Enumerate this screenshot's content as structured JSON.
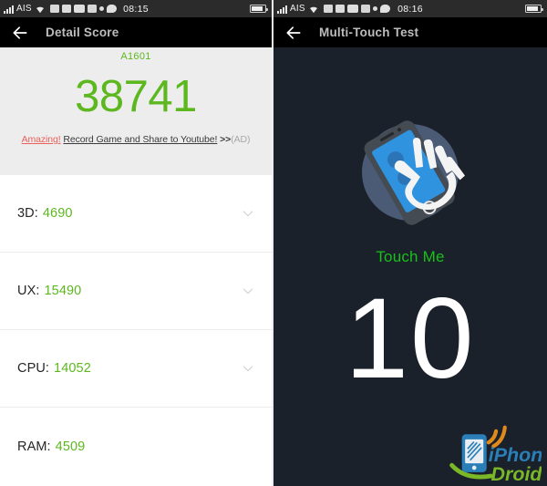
{
  "left_screen": {
    "status_bar": {
      "carrier": "AIS",
      "time": "08:15",
      "icons": [
        "signal-bars-icon",
        "wifi-icon",
        "app-icon",
        "app-icon",
        "app-icon",
        "app-icon",
        "dot-icon",
        "chat-bubble-icon",
        "battery-icon"
      ]
    },
    "app_bar": {
      "back_label": "back-arrow-icon",
      "title": "Detail Score"
    },
    "summary": {
      "device_model": "A1601",
      "total_score": "38741",
      "ad": {
        "highlight": "Amazing!",
        "message": "Record Game and Share to Youtube!",
        "arrows": ">>",
        "tag": "(AD)"
      }
    },
    "scores": [
      {
        "label": "3D:",
        "value": "4690",
        "has_chevron": true
      },
      {
        "label": "UX:",
        "value": "15490",
        "has_chevron": true
      },
      {
        "label": "CPU:",
        "value": "14052",
        "has_chevron": true
      },
      {
        "label": "RAM:",
        "value": "4509",
        "has_chevron": false
      }
    ]
  },
  "right_screen": {
    "status_bar": {
      "carrier": "AIS",
      "time": "08:16"
    },
    "app_bar": {
      "title": "Multi-Touch Test"
    },
    "touch_test": {
      "icon_name": "hand-on-phone-icon",
      "prompt": "Touch Me",
      "count": "10"
    },
    "watermark": {
      "name_primary": "iPhone",
      "name_secondary": "Droid"
    }
  },
  "colors": {
    "accent_green": "#5cb81e",
    "prompt_green": "#18c018",
    "ad_red": "#e8615a",
    "header_gray": "#ededed",
    "dark_navy": "#1b212b",
    "app_bar_black": "#000000",
    "status_bar_gray": "#2b2b2b"
  }
}
